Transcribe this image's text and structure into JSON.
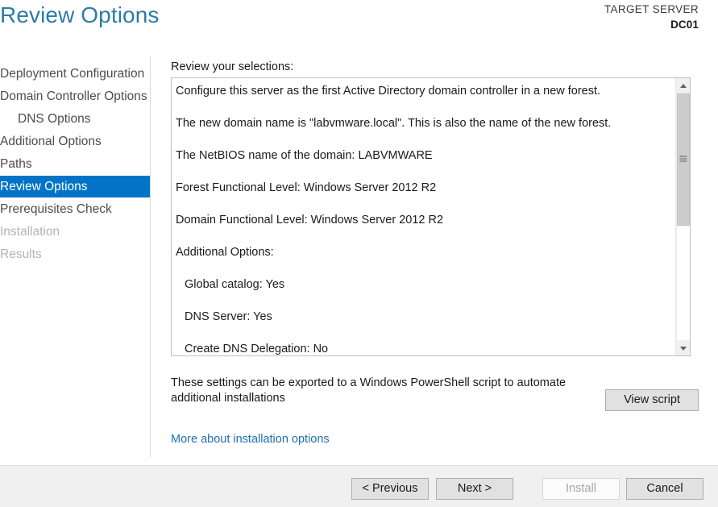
{
  "header": {
    "title": "Review Options",
    "target_server_label": "TARGET SERVER",
    "target_server_name": "DC01",
    "title_color": "#2c7ca3"
  },
  "sidebar": {
    "selected_color": "#0174c8",
    "items": [
      {
        "label": "Deployment Configuration",
        "state": "normal",
        "indent": false
      },
      {
        "label": "Domain Controller Options",
        "state": "normal",
        "indent": false
      },
      {
        "label": "DNS Options",
        "state": "normal",
        "indent": true
      },
      {
        "label": "Additional Options",
        "state": "normal",
        "indent": false
      },
      {
        "label": "Paths",
        "state": "normal",
        "indent": false
      },
      {
        "label": "Review Options",
        "state": "selected",
        "indent": false
      },
      {
        "label": "Prerequisites Check",
        "state": "normal",
        "indent": false
      },
      {
        "label": "Installation",
        "state": "disabled",
        "indent": false
      },
      {
        "label": "Results",
        "state": "disabled",
        "indent": false
      }
    ]
  },
  "main": {
    "review_label": "Review your selections:",
    "review_lines": [
      {
        "text": "Configure this server as the first Active Directory domain controller in a new forest.",
        "sub": false
      },
      {
        "text": "The new domain name is \"labvmware.local\". This is also the name of the new forest.",
        "sub": false
      },
      {
        "text": "The NetBIOS name of the domain: LABVMWARE",
        "sub": false
      },
      {
        "text": "Forest Functional Level: Windows Server 2012 R2",
        "sub": false
      },
      {
        "text": "Domain Functional Level: Windows Server 2012 R2",
        "sub": false
      },
      {
        "text": "Additional Options:",
        "sub": false
      },
      {
        "text": "Global catalog: Yes",
        "sub": true
      },
      {
        "text": "DNS Server: Yes",
        "sub": true
      },
      {
        "text": "Create DNS Delegation: No",
        "sub": true
      }
    ],
    "export_note": "These settings can be exported to a Windows PowerShell script to automate additional installations",
    "view_script_label": "View script",
    "more_about_link": "More about installation options",
    "link_color": "#1f6fb0",
    "scrollbar": {
      "up_icon": "chevron-up-icon",
      "down_icon": "chevron-down-icon",
      "thumb_grip_icon": "scrollbar-grip-icon"
    }
  },
  "footer": {
    "previous_label": "< Previous",
    "next_label": "Next >",
    "install_label": "Install",
    "install_enabled": false,
    "cancel_label": "Cancel"
  }
}
